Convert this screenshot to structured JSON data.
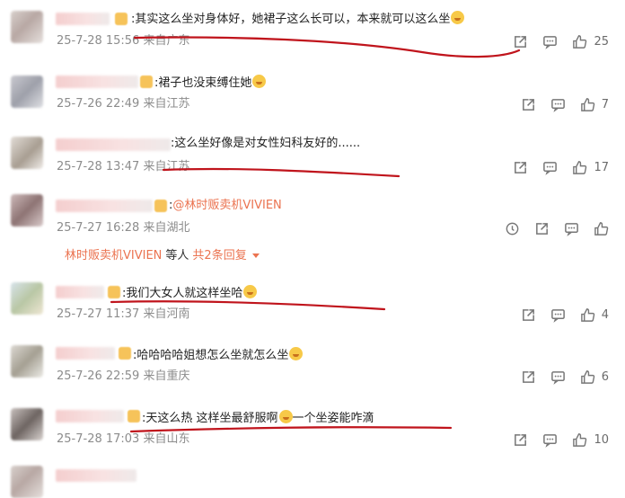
{
  "comments": [
    {
      "text": ":其实这么坐对身体好，她裙子这么长可以，本来就可以这么坐",
      "time": "25-7-28 15:56",
      "location": "来自广东",
      "likes": "25",
      "has_emoji": true
    },
    {
      "text": ":裙子也没束缚住她",
      "time": "25-7-26 22:49",
      "location": "来自江苏",
      "likes": "7",
      "has_emoji": true
    },
    {
      "text": ":这么坐好像是对女性妇科友好的......",
      "time": "25-7-28 13:47",
      "location": "来自江苏",
      "likes": "17",
      "has_emoji": false
    },
    {
      "text_prefix": ":",
      "mention": "@林时贩卖机VIVIEN",
      "time": "25-7-27 16:28",
      "location": "来自湖北",
      "likes": "",
      "has_emoji": false
    },
    {
      "text": ":我们大女人就这样坐哈",
      "time": "25-7-27 11:37",
      "location": "来自河南",
      "likes": "4",
      "has_emoji": true
    },
    {
      "text": ":哈哈哈哈姐想怎么坐就怎么坐",
      "time": "25-7-26 22:59",
      "location": "来自重庆",
      "likes": "6",
      "has_emoji": true
    },
    {
      "text": ":天这么热 这样坐最舒服啊",
      "text_after": "一个坐姿能咋滴",
      "time": "25-7-28 17:03",
      "location": "来自山东",
      "likes": "10",
      "has_emoji": true
    }
  ],
  "reply_summary": {
    "who": "林时贩卖机VIVIEN",
    "middle": "等人",
    "more": "共2条回复"
  },
  "icons": [
    "share-icon",
    "comment-icon",
    "like-icon",
    "more-icon"
  ],
  "colors": {
    "accent": "#eb7350",
    "meta": "#8c8c8c",
    "annotation": "#c0141c"
  }
}
